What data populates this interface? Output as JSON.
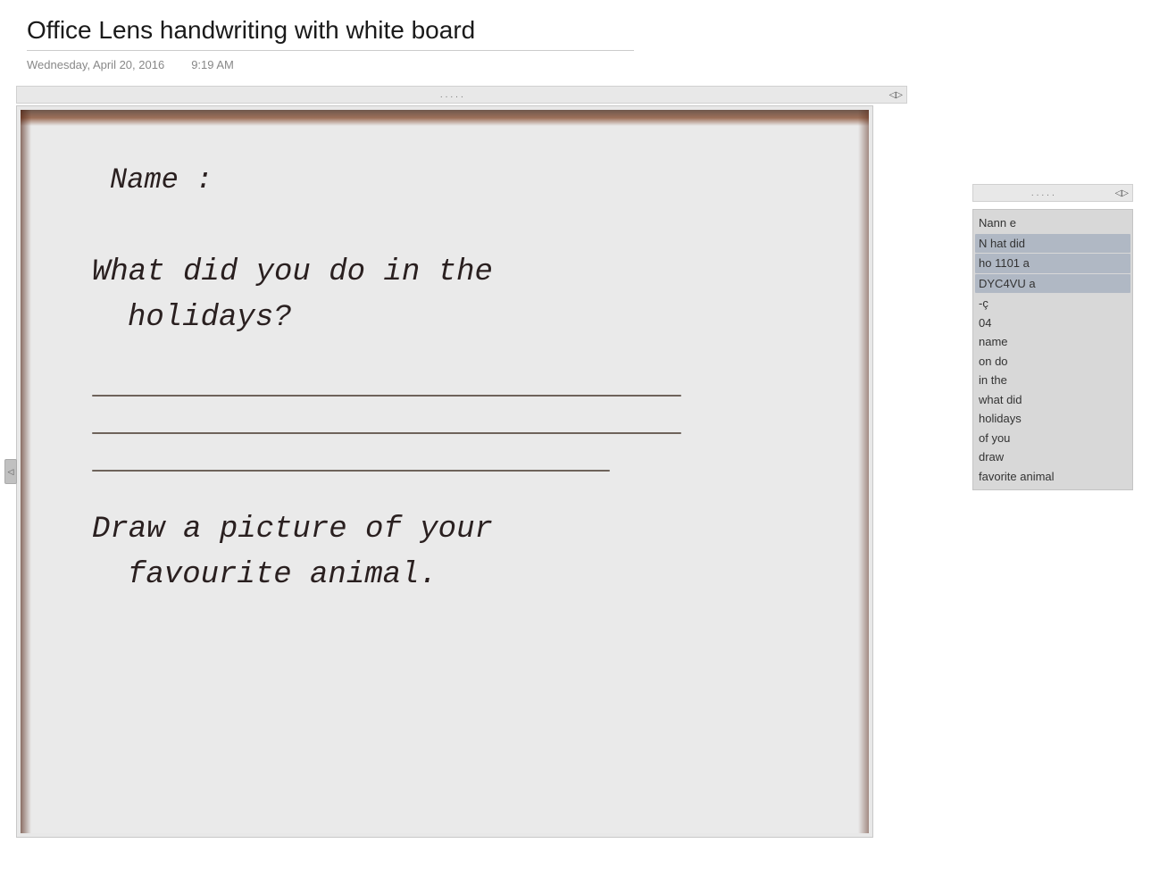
{
  "header": {
    "title": "Office Lens handwriting with white board",
    "date": "Wednesday, April 20, 2016",
    "time": "9:19 AM"
  },
  "scroll_top": {
    "dots": ".....",
    "arrows": "◁▷"
  },
  "whiteboard": {
    "name_label": "Name :",
    "question_line1": "What did you do in the",
    "question_line2": "holidays?",
    "draw_line1": "Draw a picture of your",
    "draw_line2": "favourite animal."
  },
  "right_panel": {
    "scroll_dots": ".....",
    "scroll_arrows": "◁▷",
    "items": [
      {
        "text": "Nann e",
        "highlighted": false
      },
      {
        "text": "N hat did",
        "highlighted": true
      },
      {
        "text": "ho 1101 a",
        "highlighted": true
      },
      {
        "text": "DYC4VU a",
        "highlighted": true
      },
      {
        "text": "-ç",
        "highlighted": false
      },
      {
        "text": "04",
        "highlighted": false
      },
      {
        "text": "name",
        "highlighted": false
      },
      {
        "text": "on do",
        "highlighted": false
      },
      {
        "text": "in the",
        "highlighted": false
      },
      {
        "text": "what did",
        "highlighted": false
      },
      {
        "text": "holidays",
        "highlighted": false
      },
      {
        "text": "of you",
        "highlighted": false
      },
      {
        "text": "draw",
        "highlighted": false
      },
      {
        "text": "favorite animal",
        "highlighted": false
      }
    ]
  }
}
